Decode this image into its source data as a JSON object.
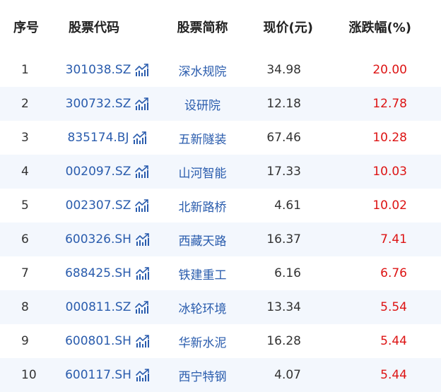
{
  "headers": {
    "index": "序号",
    "code": "股票代码",
    "name": "股票简称",
    "price": "现价(元)",
    "change": "涨跌幅(%)"
  },
  "colors": {
    "link": "#2a5cad",
    "up": "#dd1414",
    "stripe": "#f3f7fd"
  },
  "icons": {
    "code_icon": "line-chart-icon"
  },
  "rows": [
    {
      "index": "1",
      "code": "301038.SZ",
      "name": "深水规院",
      "price": "34.98",
      "change": "20.00"
    },
    {
      "index": "2",
      "code": "300732.SZ",
      "name": "设研院",
      "price": "12.18",
      "change": "12.78"
    },
    {
      "index": "3",
      "code": "835174.BJ",
      "name": "五新隧装",
      "price": "67.46",
      "change": "10.28"
    },
    {
      "index": "4",
      "code": "002097.SZ",
      "name": "山河智能",
      "price": "17.33",
      "change": "10.03"
    },
    {
      "index": "5",
      "code": "002307.SZ",
      "name": "北新路桥",
      "price": "4.61",
      "change": "10.02"
    },
    {
      "index": "6",
      "code": "600326.SH",
      "name": "西藏天路",
      "price": "16.37",
      "change": "7.41"
    },
    {
      "index": "7",
      "code": "688425.SH",
      "name": "铁建重工",
      "price": "6.16",
      "change": "6.76"
    },
    {
      "index": "8",
      "code": "000811.SZ",
      "name": "冰轮环境",
      "price": "13.34",
      "change": "5.54"
    },
    {
      "index": "9",
      "code": "600801.SH",
      "name": "华新水泥",
      "price": "16.28",
      "change": "5.44"
    },
    {
      "index": "10",
      "code": "600117.SH",
      "name": "西宁特钢",
      "price": "4.07",
      "change": "5.44"
    }
  ]
}
